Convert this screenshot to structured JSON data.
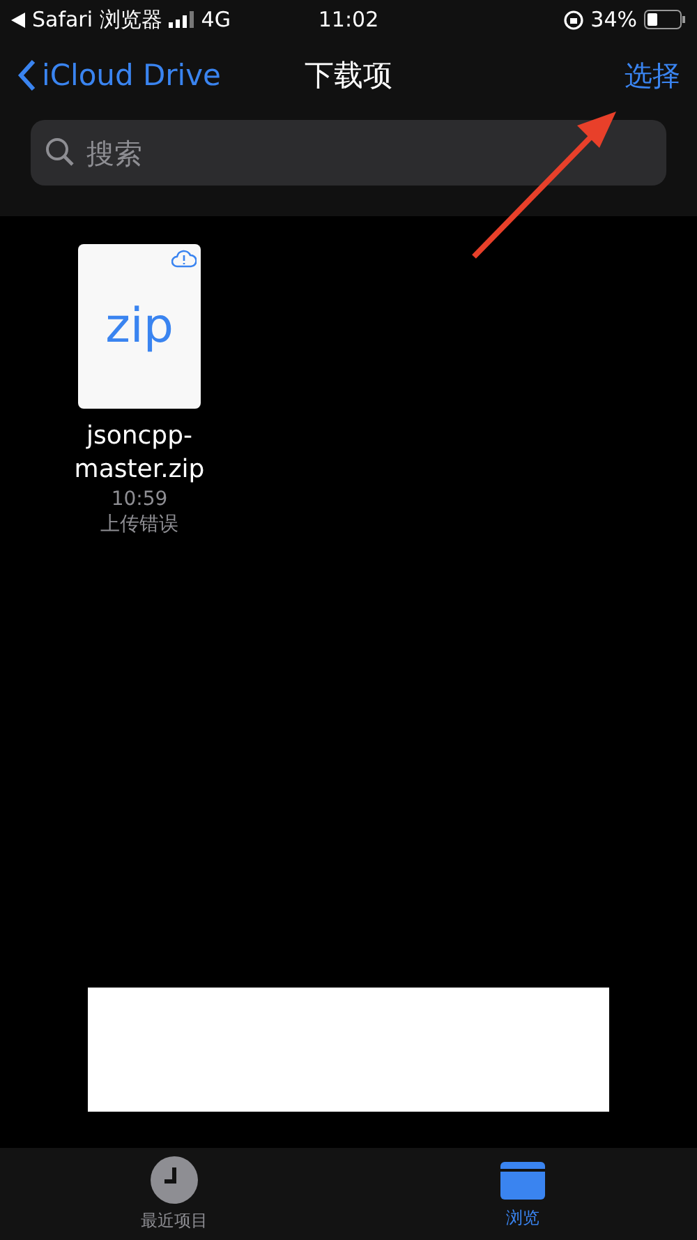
{
  "status_bar": {
    "back_app": "Safari 浏览器",
    "network": "4G",
    "time": "11:02",
    "battery": "34%"
  },
  "nav": {
    "back": "iCloud Drive",
    "title": "下载项",
    "action": "选择"
  },
  "search": {
    "placeholder": "搜索"
  },
  "files": [
    {
      "icon_label": "zip",
      "name": "jsoncpp-master.zip",
      "time": "10:59",
      "status": "上传错误"
    }
  ],
  "tabs": [
    {
      "label": "最近项目",
      "selected": false
    },
    {
      "label": "浏览",
      "selected": true
    }
  ]
}
